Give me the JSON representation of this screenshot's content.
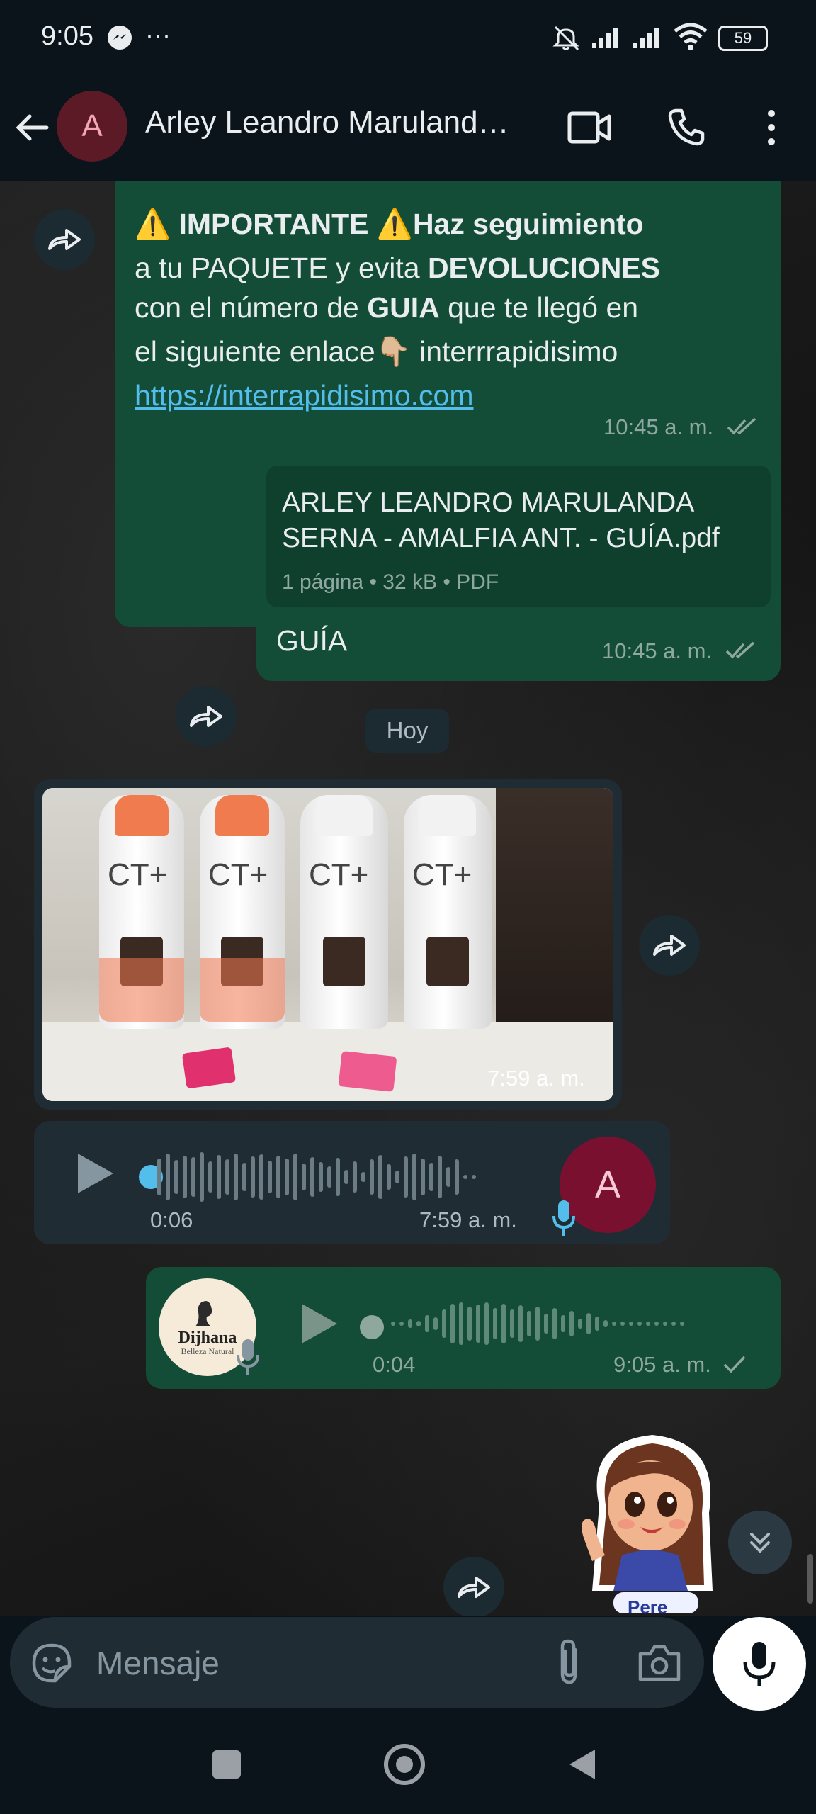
{
  "status": {
    "time": "9:05",
    "battery": "59"
  },
  "header": {
    "avatar_letter": "A",
    "contact_name": "Arley Leandro Maruland…"
  },
  "messages": {
    "important": {
      "line1_a": "IMPORTANTE",
      "line1_b": "Haz seguimiento",
      "line2_a": "a tu PAQUETE y evita ",
      "line2_b": "DEVOLUCIONES",
      "line3_a": "con el número de ",
      "line3_b": "GUIA",
      "line3_c": " que te llegó en",
      "line4": "el siguiente enlace",
      "line4_b": " interrrapidisimo",
      "link": "https://interrapidisimo.com",
      "time": "10:45 a. m."
    },
    "document": {
      "file_name": "ARLEY LEANDRO MARULANDA SERNA - AMALFIA ANT. - GUÍA.pdf",
      "file_info": "1 página • 32 kB • PDF",
      "caption": "GUÍA",
      "time": "10:45 a. m."
    },
    "date_divider": "Hoy",
    "image": {
      "time": "7:59 a. m.",
      "product_label": "CT+"
    },
    "voice_in": {
      "duration": "0:06",
      "time": "7:59 a. m.",
      "avatar_letter": "A"
    },
    "voice_out": {
      "duration": "0:04",
      "time": "9:05 a. m.",
      "avatar_brand": "Dijhana",
      "avatar_sub": "Belleza Natural"
    },
    "sticker": {
      "text": "Pere"
    }
  },
  "input": {
    "placeholder": "Mensaje"
  },
  "colors": {
    "outgoing": "#134d37",
    "incoming": "#202c33",
    "link": "#53bdeb",
    "tick_blue": "#53bdeb"
  }
}
